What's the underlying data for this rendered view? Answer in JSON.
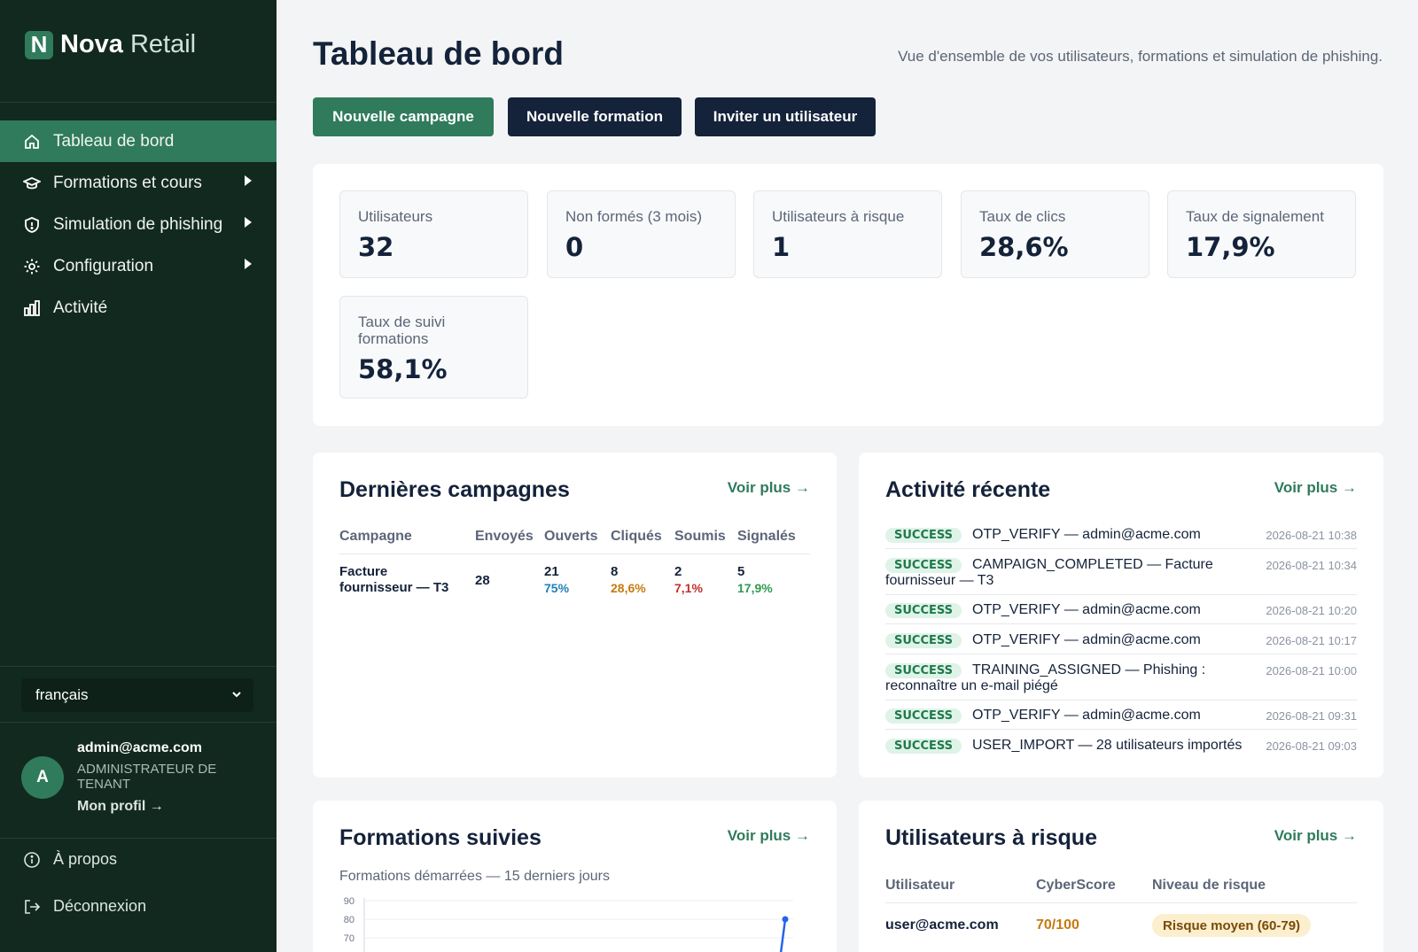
{
  "brand": {
    "letter": "N",
    "name_bold": "Nova",
    "name_light": "Retail"
  },
  "nav": [
    {
      "label": "Tableau de bord",
      "active": true,
      "submenu": false
    },
    {
      "label": "Formations et cours",
      "active": false,
      "submenu": true
    },
    {
      "label": "Simulation de phishing",
      "active": false,
      "submenu": true
    },
    {
      "label": "Configuration",
      "active": false,
      "submenu": true
    },
    {
      "label": "Activité",
      "active": false,
      "submenu": false
    }
  ],
  "language": {
    "selected": "français"
  },
  "user": {
    "initial": "A",
    "email": "admin@acme.com",
    "role": "ADMINISTRATEUR DE TENANT",
    "profile_link": "Mon profil →"
  },
  "footer": {
    "about": "À propos",
    "logout": "Déconnexion"
  },
  "header": {
    "title": "Tableau de bord",
    "subtitle": "Vue d'ensemble de vos utilisateurs, formations et simulation de phishing."
  },
  "actions": {
    "new_campaign": "Nouvelle campagne",
    "new_training": "Nouvelle formation",
    "invite_user": "Inviter un utilisateur"
  },
  "stats": [
    {
      "label": "Utilisateurs",
      "value": "32"
    },
    {
      "label": "Non formés (3 mois)",
      "value": "0"
    },
    {
      "label": "Utilisateurs à risque",
      "value": "1"
    },
    {
      "label": "Taux de clics",
      "value": "28,6%"
    },
    {
      "label": "Taux de signalement",
      "value": "17,9%"
    },
    {
      "label": "Taux de suivi formations",
      "value": "58,1%"
    }
  ],
  "campaigns": {
    "title": "Dernières campagnes",
    "more": "Voir plus →",
    "columns": [
      "Campagne",
      "Envoyés",
      "Ouverts",
      "Cliqués",
      "Soumis",
      "Signalés"
    ],
    "rows": [
      {
        "name": "Facture fournisseur — T3",
        "sent": "28",
        "opened": "21",
        "opened_pct": "75%",
        "clicked": "8",
        "clicked_pct": "28,6%",
        "submitted": "2",
        "submitted_pct": "7,1%",
        "reported": "5",
        "reported_pct": "17,9%"
      }
    ]
  },
  "activity": {
    "title": "Activité récente",
    "more": "Voir plus →",
    "items": [
      {
        "status": "SUCCESS",
        "text": "OTP_VERIFY — admin@acme.com",
        "time": "2026-08-21 10:38"
      },
      {
        "status": "SUCCESS",
        "text": "CAMPAIGN_COMPLETED — Facture fournisseur — T3",
        "time": "2026-08-21 10:34"
      },
      {
        "status": "SUCCESS",
        "text": "OTP_VERIFY — admin@acme.com",
        "time": "2026-08-21 10:20"
      },
      {
        "status": "SUCCESS",
        "text": "OTP_VERIFY — admin@acme.com",
        "time": "2026-08-21 10:17"
      },
      {
        "status": "SUCCESS",
        "text": "TRAINING_ASSIGNED — Phishing : reconnaître un e-mail piégé",
        "time": "2026-08-21 10:00"
      },
      {
        "status": "SUCCESS",
        "text": "OTP_VERIFY — admin@acme.com",
        "time": "2026-08-21 09:31"
      },
      {
        "status": "SUCCESS",
        "text": "USER_IMPORT — 28 utilisateurs importés",
        "time": "2026-08-21 09:03"
      }
    ]
  },
  "trainings": {
    "title": "Formations suivies",
    "more": "Voir plus →",
    "subtitle": "Formations démarrées — 15 derniers jours"
  },
  "risk_users": {
    "title": "Utilisateurs à risque",
    "more": "Voir plus →",
    "columns": [
      "Utilisateur",
      "CyberScore",
      "Niveau de risque"
    ],
    "rows": [
      {
        "user": "user@acme.com",
        "score": "70/100",
        "level": "Risque moyen (60-79)"
      }
    ]
  },
  "colors": {
    "sidebar": "#12291f",
    "accent": "#2f7b5c",
    "dark_button": "#14223a",
    "opened": "#1f7fb8",
    "clicked": "#c77a10",
    "submitted": "#c0302b",
    "reported": "#2e9a50",
    "line": "#2563eb"
  },
  "chart_data": {
    "type": "line",
    "title": "Formations démarrées — 15 derniers jours",
    "y_ticks": [
      90,
      80,
      70
    ],
    "series": [
      {
        "values_visible_tail": [
          90
        ]
      }
    ]
  }
}
